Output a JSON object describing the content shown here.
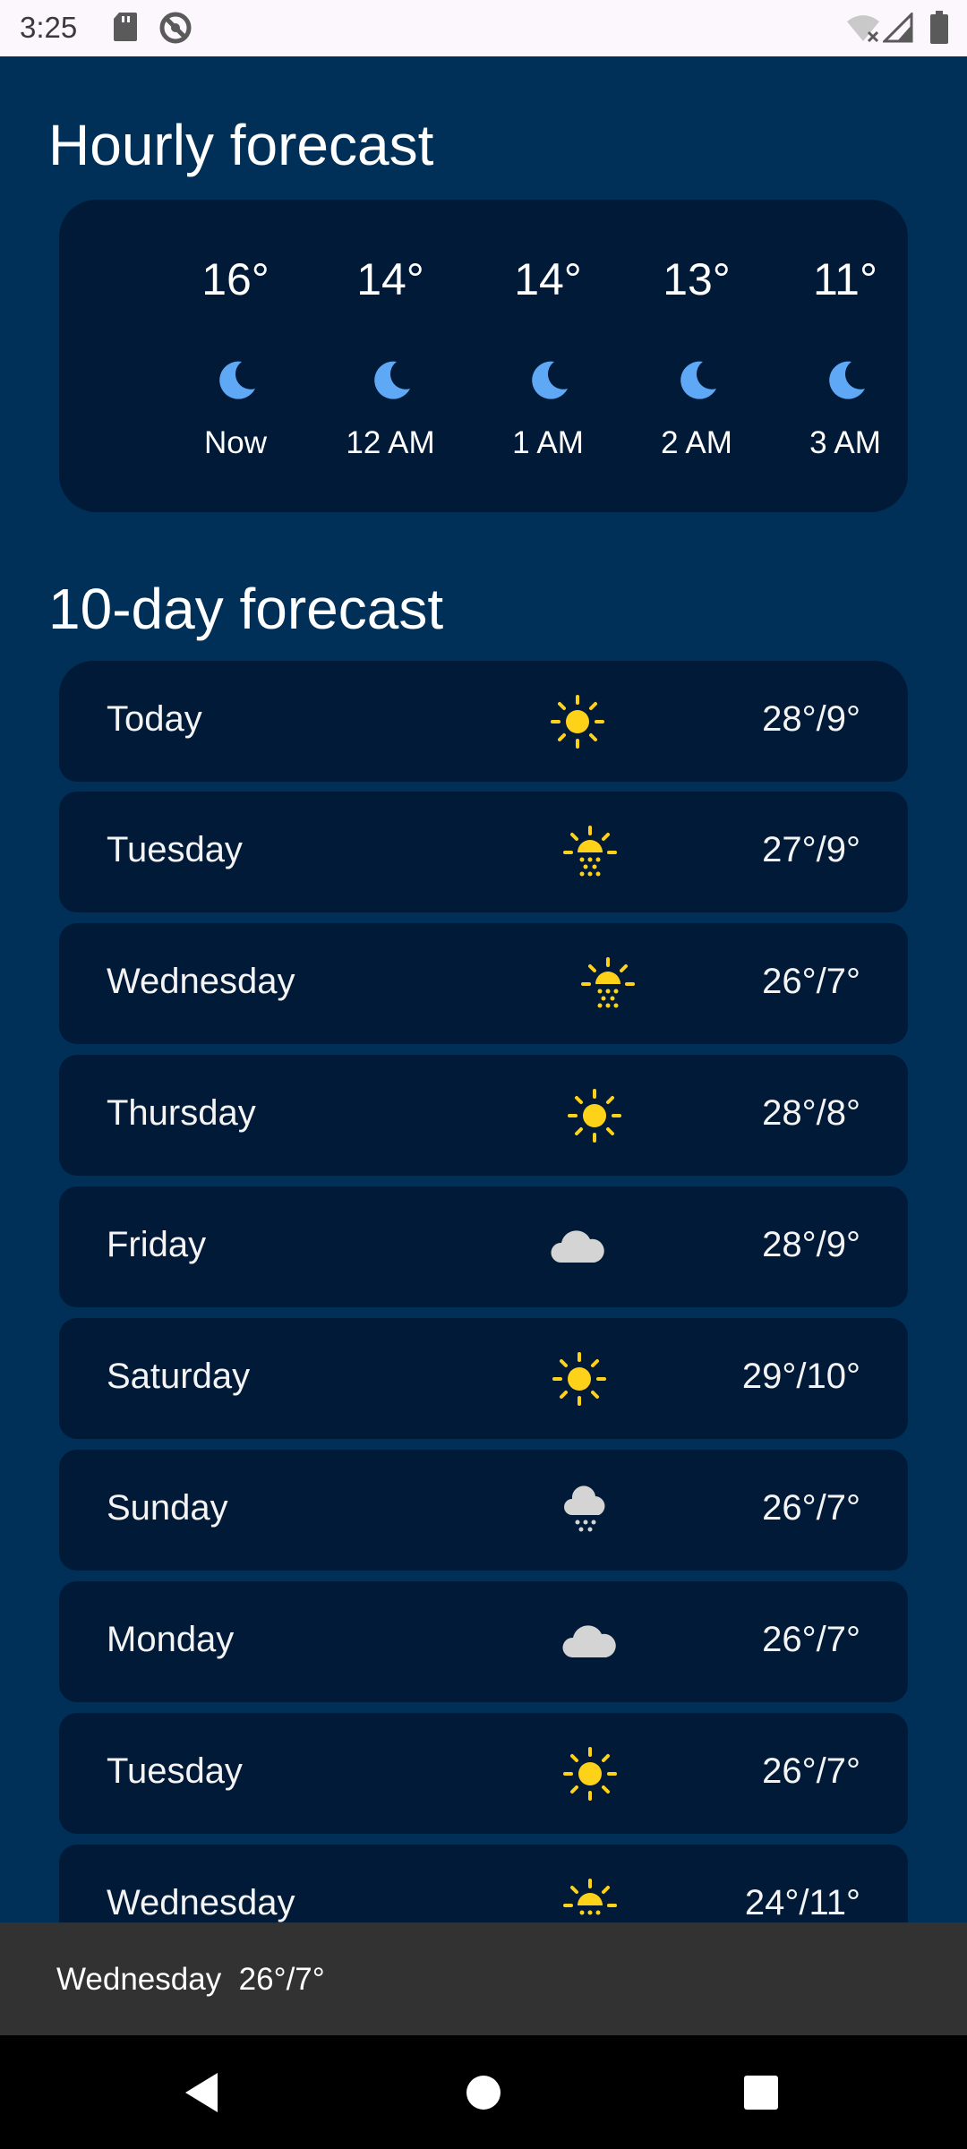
{
  "status_bar": {
    "time": "3:25",
    "icons": [
      "sd-card-icon",
      "do-not-disturb-icon",
      "wifi-off-icon",
      "signal-icon",
      "battery-icon"
    ]
  },
  "hourly": {
    "title": "Hourly forecast",
    "items": [
      {
        "temp": "16°",
        "label": "Now",
        "icon": "moon-icon"
      },
      {
        "temp": "14°",
        "label": "12 AM",
        "icon": "moon-icon"
      },
      {
        "temp": "14°",
        "label": "1 AM",
        "icon": "moon-icon"
      },
      {
        "temp": "13°",
        "label": "2 AM",
        "icon": "moon-icon"
      },
      {
        "temp": "11°",
        "label": "3 AM",
        "icon": "moon-icon"
      }
    ]
  },
  "daily": {
    "title": "10-day forecast",
    "items": [
      {
        "day": "Today",
        "temps": "28°/9°",
        "icon": "sunny-icon"
      },
      {
        "day": "Tuesday",
        "temps": "27°/9°",
        "icon": "sunny-haze-icon"
      },
      {
        "day": "Wednesday",
        "temps": "26°/7°",
        "icon": "sunny-haze-icon"
      },
      {
        "day": "Thursday",
        "temps": "28°/8°",
        "icon": "sunny-icon"
      },
      {
        "day": "Friday",
        "temps": "28°/9°",
        "icon": "cloud-icon"
      },
      {
        "day": "Saturday",
        "temps": "29°/10°",
        "icon": "sunny-icon"
      },
      {
        "day": "Sunday",
        "temps": "26°/7°",
        "icon": "snow-cloud-icon"
      },
      {
        "day": "Monday",
        "temps": "26°/7°",
        "icon": "cloud-icon"
      },
      {
        "day": "Tuesday",
        "temps": "26°/7°",
        "icon": "sunny-icon"
      },
      {
        "day": "Wednesday",
        "temps": "24°/11°",
        "icon": "sunny-haze-icon"
      }
    ]
  },
  "snackbar": {
    "day": "Wednesday",
    "temps": "26°/7°"
  },
  "nav": {
    "icons": [
      "back-icon",
      "home-icon",
      "recents-icon"
    ]
  },
  "colors": {
    "background": "#002f57",
    "card": "#001a38",
    "sun": "#ffd21a",
    "moon": "#5fa8f5",
    "cloud": "#d4d4d4"
  }
}
